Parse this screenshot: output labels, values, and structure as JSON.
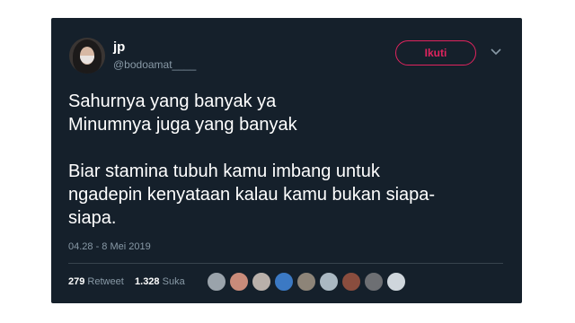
{
  "user": {
    "name": "jp",
    "handle": "@bodoamat____"
  },
  "header": {
    "follow_label": "Ikuti"
  },
  "tweet": {
    "lines_1": [
      "Sahurnya yang banyak ya",
      "Minumnya juga yang banyak"
    ],
    "line_2a": "Biar stamina tubuh kamu imbang untuk",
    "line_2b": "ngadepin kenyataan kalau kamu bukan siapa-",
    "line_2c": "siapa.",
    "timestamp": "04.28 - 8 Mei 2019"
  },
  "stats": {
    "retweet_count": "279",
    "retweet_label": "Retweet",
    "like_count": "1.328",
    "like_label": "Suka"
  },
  "likers": [
    {
      "color": "#9aa3ab"
    },
    {
      "color": "#c98b7a"
    },
    {
      "color": "#b9b0aa"
    },
    {
      "color": "#3b79c4"
    },
    {
      "color": "#8d8478"
    },
    {
      "color": "#aab8c2"
    },
    {
      "color": "#8a4d3e"
    },
    {
      "color": "#6d6f73"
    },
    {
      "color": "#cfd6dc"
    }
  ],
  "colors": {
    "background": "#15202b",
    "accent": "#e0245e",
    "text": "#ffffff",
    "muted": "#8899a6"
  }
}
